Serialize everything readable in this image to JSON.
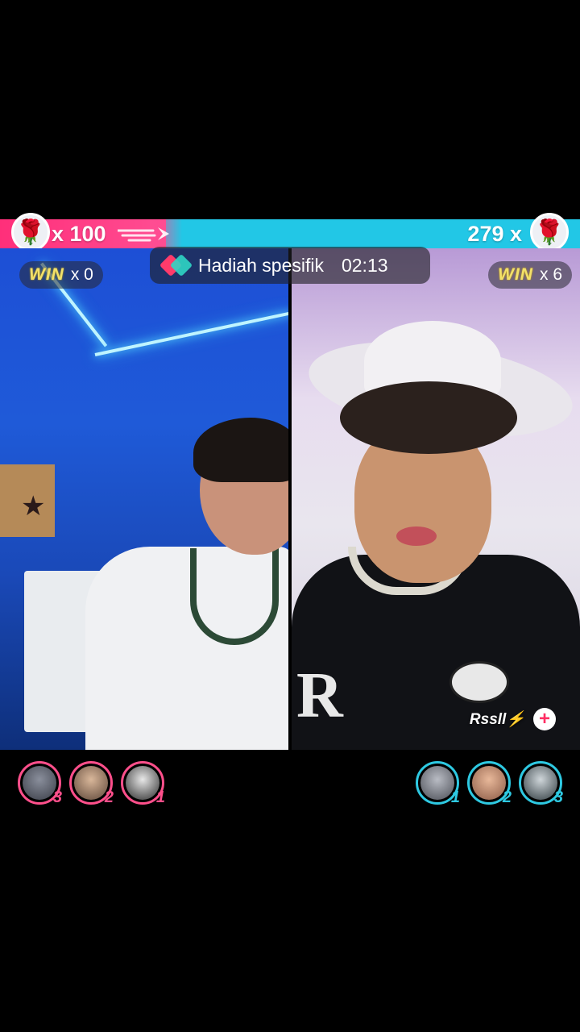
{
  "battle": {
    "left_score": "x 100",
    "right_score": "279 x",
    "gift_icon": "rose-icon",
    "colors": {
      "left": "#ff2f7a",
      "right": "#22c7e6"
    }
  },
  "win": {
    "label": "WIN",
    "left_count": "x 0",
    "right_count": "x 6"
  },
  "gift_banner": {
    "text": "Hadiah spesifik",
    "timer": "02:13"
  },
  "host": {
    "name": "Rssll⚡",
    "follow_icon": "plus-icon"
  },
  "gifters": {
    "left": [
      {
        "rank": "3"
      },
      {
        "rank": "2"
      },
      {
        "rank": "1"
      }
    ],
    "right": [
      {
        "rank": "1"
      },
      {
        "rank": "2"
      },
      {
        "rank": "3"
      }
    ]
  }
}
